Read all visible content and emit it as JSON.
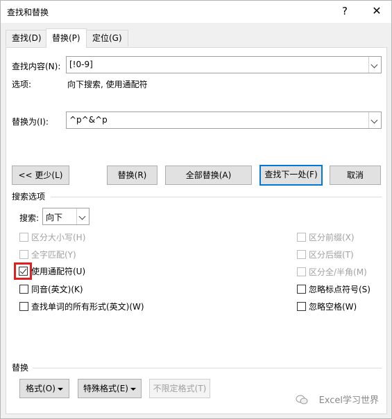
{
  "window": {
    "title": "查找和替换",
    "help_glyph": "?",
    "close_glyph": "✕"
  },
  "tabs": [
    {
      "label": "查找(D)",
      "active": false
    },
    {
      "label": "替换(P)",
      "active": true
    },
    {
      "label": "定位(G)",
      "active": false
    }
  ],
  "find": {
    "label": "查找内容(N):",
    "value": "[!0-9]"
  },
  "options": {
    "label": "选项:",
    "value": "向下搜索, 使用通配符"
  },
  "replace": {
    "label": "替换为(I):",
    "value": "^p^&^p"
  },
  "buttons": {
    "less": "<< 更少(L)",
    "replace": "替换(R)",
    "replace_all": "全部替换(A)",
    "find_next": "查找下一处(F)",
    "cancel": "取消"
  },
  "search_options": {
    "title": "搜索选项",
    "search_label": "搜索:",
    "direction": "向下"
  },
  "checkboxes_left": [
    {
      "label": "区分大小写(H)",
      "checked": false,
      "disabled": true
    },
    {
      "label": "全字匹配(Y)",
      "checked": false,
      "disabled": true
    },
    {
      "label": "使用通配符(U)",
      "checked": true,
      "disabled": false
    },
    {
      "label": "同音(英文)(K)",
      "checked": false,
      "disabled": false
    },
    {
      "label": "查找单词的所有形式(英文)(W)",
      "checked": false,
      "disabled": false
    }
  ],
  "checkboxes_right": [
    {
      "label": "区分前缀(X)",
      "checked": false,
      "disabled": true
    },
    {
      "label": "区分后缀(T)",
      "checked": false,
      "disabled": true
    },
    {
      "label": "区分全/半角(M)",
      "checked": false,
      "disabled": true
    },
    {
      "label": "忽略标点符号(S)",
      "checked": false,
      "disabled": false
    },
    {
      "label": "忽略空格(W)",
      "checked": false,
      "disabled": false
    }
  ],
  "replace_section": {
    "title": "替换",
    "format": "格式(O)",
    "special": "特殊格式(E)",
    "no_format": "不限定格式(T)"
  },
  "watermark": "Excel学习世界",
  "colors": {
    "accent": "#0078d7",
    "highlight": "#e02020"
  }
}
